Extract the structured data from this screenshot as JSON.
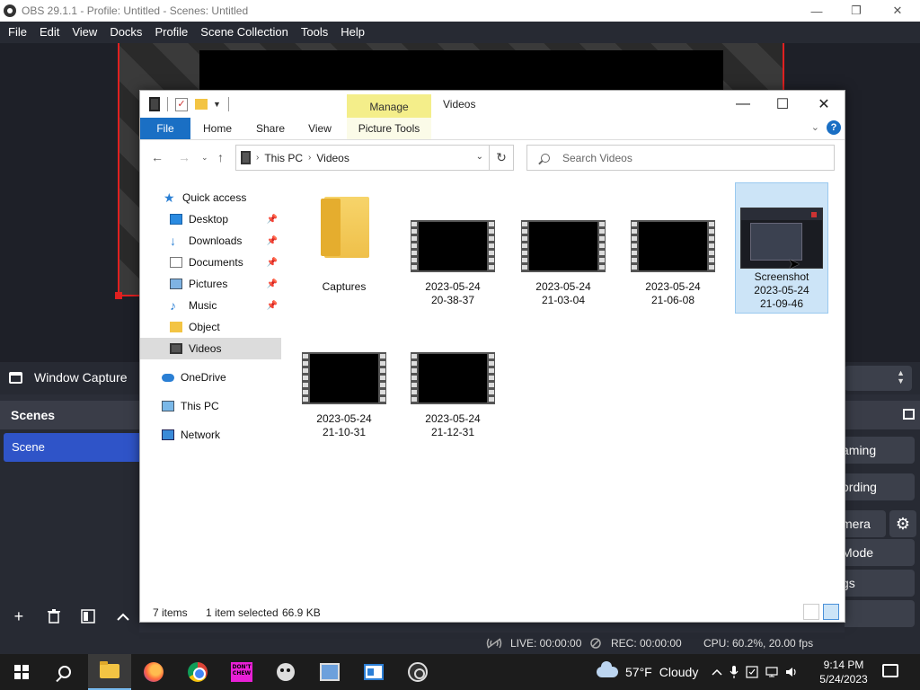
{
  "obs": {
    "title": "OBS 29.1.1 - Profile: Untitled - Scenes: Untitled",
    "menu": [
      "File",
      "Edit",
      "View",
      "Docks",
      "Profile",
      "Scene Collection",
      "Tools",
      "Help"
    ],
    "window_controls": {
      "minimize": "—",
      "maximize": "❐",
      "close": "✕"
    },
    "source_label": "Window Capture",
    "scenes_header": "Scenes",
    "scene_item": "Scene",
    "controls": [
      "aming",
      "ording",
      "mera",
      "Mode",
      "gs"
    ],
    "status": {
      "live": "LIVE: 00:00:00",
      "rec": "REC: 00:00:00",
      "cpu": "CPU: 60.2%, 20.00 fps"
    }
  },
  "explorer": {
    "manage_tab": "Manage",
    "title": "Videos",
    "ribbon_tabs": [
      "File",
      "Home",
      "Share",
      "View",
      "Picture Tools"
    ],
    "address": {
      "root": "This PC",
      "current": "Videos"
    },
    "search_placeholder": "Search Videos",
    "nav": [
      {
        "label": "Quick access",
        "icon": "star-icon"
      },
      {
        "label": "Desktop",
        "icon": "desktop-icon",
        "pinned": true
      },
      {
        "label": "Downloads",
        "icon": "downloads-icon",
        "pinned": true
      },
      {
        "label": "Documents",
        "icon": "documents-icon",
        "pinned": true
      },
      {
        "label": "Pictures",
        "icon": "pictures-icon",
        "pinned": true
      },
      {
        "label": "Music",
        "icon": "music-icon",
        "pinned": true
      },
      {
        "label": "Object",
        "icon": "folder-icon"
      },
      {
        "label": "Videos",
        "icon": "videos-icon",
        "selected": true
      },
      {
        "label": "OneDrive",
        "icon": "onedrive-icon"
      },
      {
        "label": "This PC",
        "icon": "this-pc-icon"
      },
      {
        "label": "Network",
        "icon": "network-icon"
      }
    ],
    "files": [
      {
        "type": "folder",
        "line1": "Captures",
        "line2": "",
        "line3": ""
      },
      {
        "type": "video",
        "line1": "2023-05-24",
        "line2": "20-38-37",
        "line3": ""
      },
      {
        "type": "video",
        "line1": "2023-05-24",
        "line2": "21-03-04",
        "line3": ""
      },
      {
        "type": "video",
        "line1": "2023-05-24",
        "line2": "21-06-08",
        "line3": ""
      },
      {
        "type": "image",
        "line1": "Screenshot",
        "line2": "2023-05-24",
        "line3": "21-09-46",
        "selected": true
      },
      {
        "type": "video",
        "line1": "2023-05-24",
        "line2": "21-10-31",
        "line3": ""
      },
      {
        "type": "video",
        "line1": "2023-05-24",
        "line2": "21-12-31",
        "line3": ""
      }
    ],
    "status": {
      "count": "7 items",
      "selected": "1 item selected",
      "size": "66.9 KB"
    }
  },
  "taskbar": {
    "weather": {
      "temp": "57°F",
      "condition": "Cloudy"
    },
    "time": "9:14 PM",
    "date": "5/24/2023",
    "pink_app_text": "DON'T CHEW"
  },
  "colors": {
    "obs_bg": "#272a33",
    "scene_selected": "#2f54c8",
    "file_tab": "#1a6fc4",
    "selection": "#cce4f7",
    "manage_tab": "#f4ee8a"
  }
}
